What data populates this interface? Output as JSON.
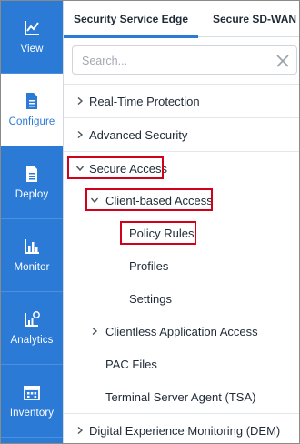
{
  "sidebar": {
    "items": [
      {
        "label": "View",
        "icon": "chart-icon",
        "active": false
      },
      {
        "label": "Configure",
        "icon": "document-icon",
        "active": true
      },
      {
        "label": "Deploy",
        "icon": "document-icon",
        "active": false
      },
      {
        "label": "Monitor",
        "icon": "bar-chart-icon",
        "active": false
      },
      {
        "label": "Analytics",
        "icon": "analytics-icon",
        "active": false
      },
      {
        "label": "Inventory",
        "icon": "inventory-icon",
        "active": false
      }
    ]
  },
  "tabs": [
    {
      "label": "Security Service Edge",
      "active": true
    },
    {
      "label": "Secure SD-WAN",
      "active": false
    }
  ],
  "search": {
    "placeholder": "Search...",
    "value": ""
  },
  "tree": {
    "realtime_protection": "Real-Time Protection",
    "advanced_security": "Advanced Security",
    "secure_access": "Secure Access",
    "client_based_access": "Client-based Access",
    "policy_rules": "Policy Rules",
    "profiles": "Profiles",
    "settings": "Settings",
    "clientless_access": "Clientless Application Access",
    "pac_files": "PAC Files",
    "terminal_server_agent": "Terminal Server Agent (TSA)",
    "dem": "Digital Experience Monitoring (DEM)"
  },
  "colors": {
    "accent": "#2b7ad6",
    "highlight": "#d0021b"
  }
}
